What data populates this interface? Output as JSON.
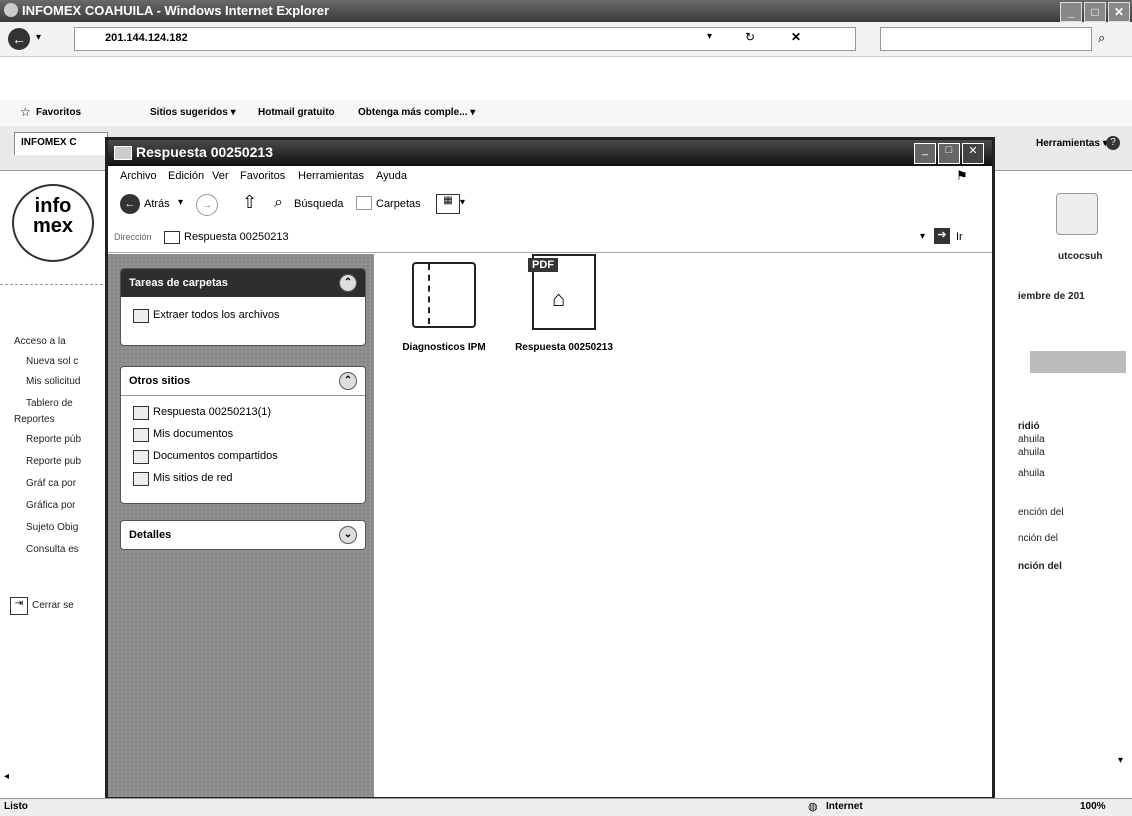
{
  "browser": {
    "title": "INFOMEX COAHUILA - Windows Internet Explorer",
    "address": "201.144.124.182",
    "favorites_label": "Favoritos",
    "fav_links": [
      "Sitios sugeridos ▾",
      "Hotmail gratuito",
      "Obtenga más comple... ▾"
    ],
    "tab_label": "INFOMEX C",
    "tools_label": "Herramientas ▾",
    "status": "Listo",
    "zone": "Internet",
    "zoom": "100%"
  },
  "page_left": {
    "logo_top": "info",
    "logo_bottom": "mex",
    "nav": [
      "Acceso a la",
      "Nueva sol c",
      "Mis solicitud",
      "Tablero de",
      "Reportes",
      "Reporte púb",
      "Reporte pub",
      "Gráf ca por",
      "Gráfica por",
      "Sujeto Obig",
      "Consulta es"
    ],
    "logout": "Cerrar se"
  },
  "page_right": {
    "logo_caption": "utcocsuh",
    "date_text": "iembre de 201",
    "lines": [
      "ridió",
      "ahuila",
      "ahuila",
      "ahuila",
      "ención del",
      "nción del",
      "nción del"
    ]
  },
  "explorer": {
    "title": "Respuesta 00250213",
    "menu": [
      "Archivo",
      "Edición",
      "Ver",
      "Favoritos",
      "Herramientas",
      "Ayuda"
    ],
    "toolbar": {
      "back": "Atrás",
      "search": "Búsqueda",
      "folders": "Carpetas"
    },
    "address_label": "Dirección",
    "address_value": "Respuesta 00250213",
    "go_label": "Ir",
    "tasks": {
      "title": "Tareas de carpetas",
      "items": [
        "Extraer todos los archivos"
      ]
    },
    "other_places": {
      "title": "Otros sitios",
      "items": [
        "Respuesta 00250213(1)",
        "Mis documentos",
        "Documentos compartidos",
        "Mis sitios de red"
      ]
    },
    "details": {
      "title": "Detalles"
    },
    "files": [
      {
        "name": "Diagnosticos IPM",
        "icon": "zip-folder-icon"
      },
      {
        "name": "Respuesta 00250213",
        "icon": "pdf-file-icon",
        "badge": "PDF"
      }
    ]
  }
}
